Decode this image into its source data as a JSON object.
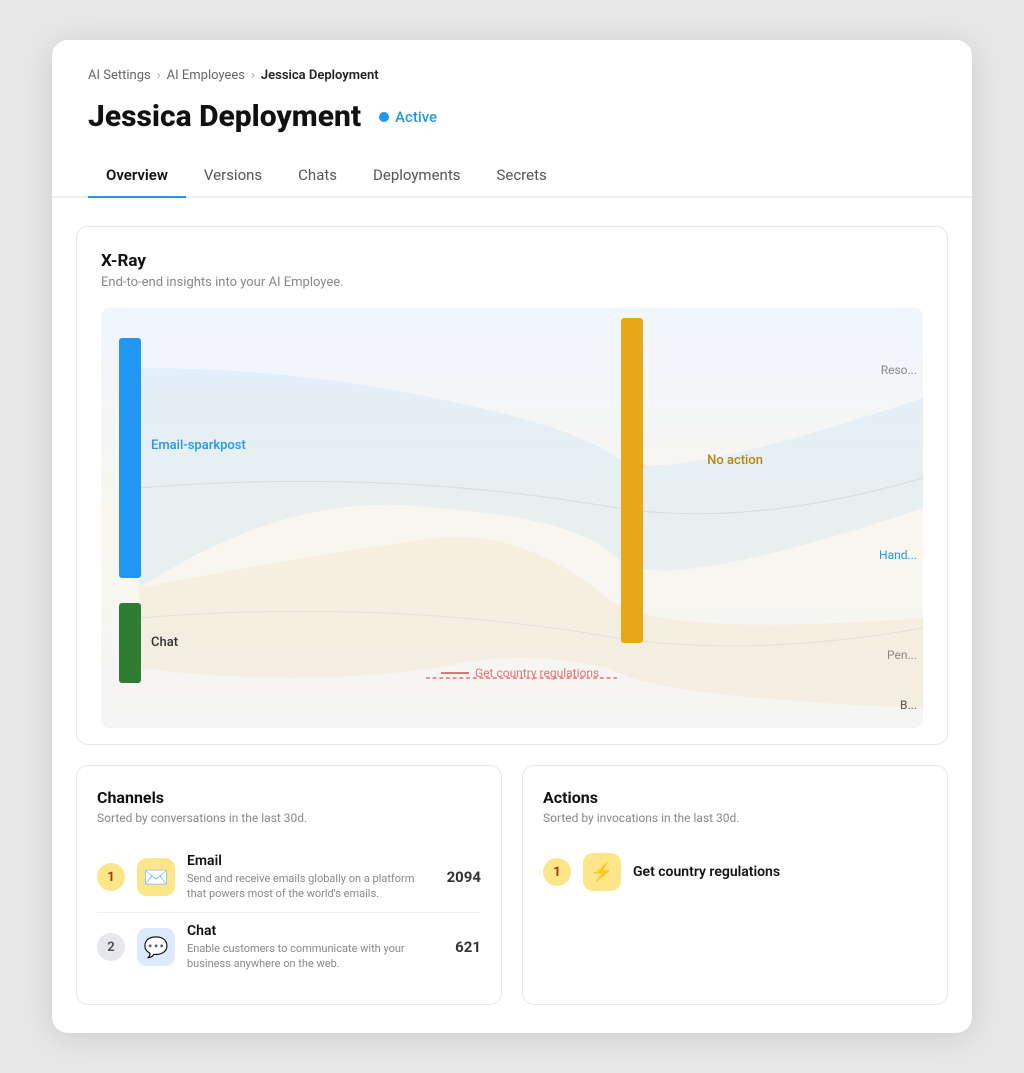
{
  "breadcrumb": {
    "items": [
      "AI Settings",
      "AI Employees",
      "Jessica Deployment"
    ],
    "separators": [
      ">",
      ">"
    ]
  },
  "page": {
    "title": "Jessica Deployment",
    "status": "Active"
  },
  "tabs": [
    {
      "label": "Overview",
      "active": true
    },
    {
      "label": "Versions",
      "active": false
    },
    {
      "label": "Chats",
      "active": false
    },
    {
      "label": "Deployments",
      "active": false
    },
    {
      "label": "Secrets",
      "active": false
    }
  ],
  "xray": {
    "title": "X-Ray",
    "subtitle": "End-to-end insights into your AI Employee.",
    "bars": {
      "email": {
        "label": "Email-sparkpost",
        "color": "#2196F3"
      },
      "chat": {
        "label": "Chat",
        "color": "#2e7d32"
      },
      "no_action": {
        "label": "No action",
        "color": "#e6a817"
      },
      "get_country": {
        "label": "Get country regulations",
        "color": "#e57373"
      }
    },
    "right_labels": {
      "reso": "Reso...",
      "hand": "Hand...",
      "pen": "Pen...",
      "b": "B..."
    }
  },
  "channels": {
    "title": "Channels",
    "subtitle": "Sorted by conversations in the last 30d.",
    "items": [
      {
        "rank": "1",
        "rank_style": "gold",
        "icon": "✉️",
        "icon_style": "email",
        "name": "Email",
        "description": "Send and receive emails globally on a platform that powers most of the world's emails.",
        "count": "2094"
      },
      {
        "rank": "2",
        "rank_style": "silver",
        "icon": "💬",
        "icon_style": "chat",
        "name": "Chat",
        "description": "Enable customers to communicate with your business anywhere on the web.",
        "count": "621"
      }
    ]
  },
  "actions": {
    "title": "Actions",
    "subtitle": "Sorted by invocations in the last 30d.",
    "items": [
      {
        "rank": "1",
        "rank_style": "gold",
        "icon": "⚡",
        "name": "Get country regulations"
      }
    ]
  }
}
